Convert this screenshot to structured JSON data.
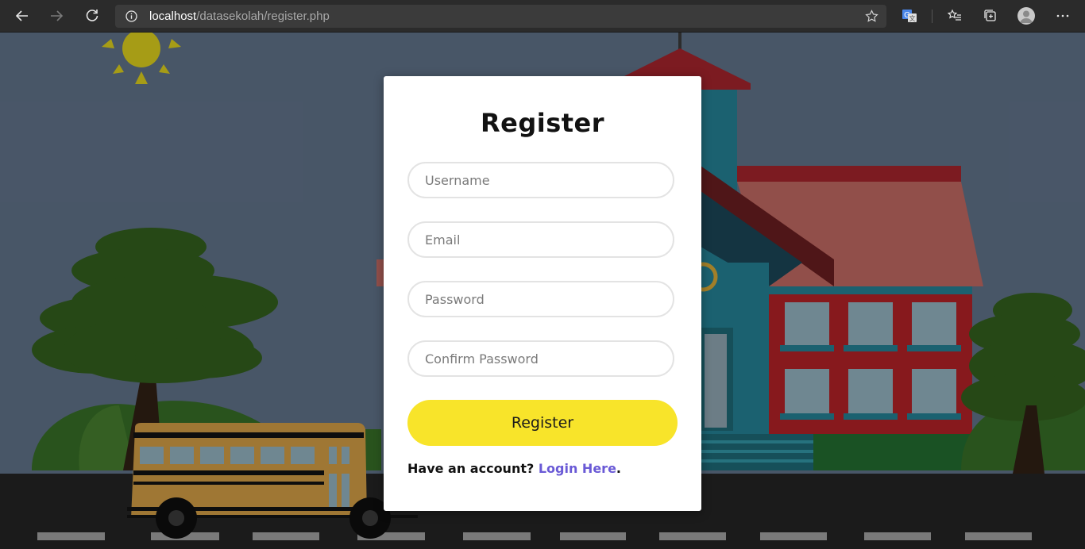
{
  "browser": {
    "url_host": "localhost",
    "url_path": "/datasekolah/register.php",
    "icons": [
      "back-icon",
      "forward-icon",
      "refresh-icon",
      "info-icon",
      "star-icon",
      "translate-icon",
      "favorites-icon",
      "collections-icon",
      "avatar",
      "more-icon"
    ]
  },
  "form": {
    "title": "Register",
    "fields": {
      "username_placeholder": "Username",
      "email_placeholder": "Email",
      "password_placeholder": "Password",
      "confirm_placeholder": "Confirm Password"
    },
    "submit_label": "Register",
    "footer_text": "Have an account? ",
    "login_link": "Login Here",
    "footer_end": "."
  },
  "colors": {
    "sky": "#536276",
    "button": "#f8e42a",
    "link": "#6a5ad6"
  }
}
